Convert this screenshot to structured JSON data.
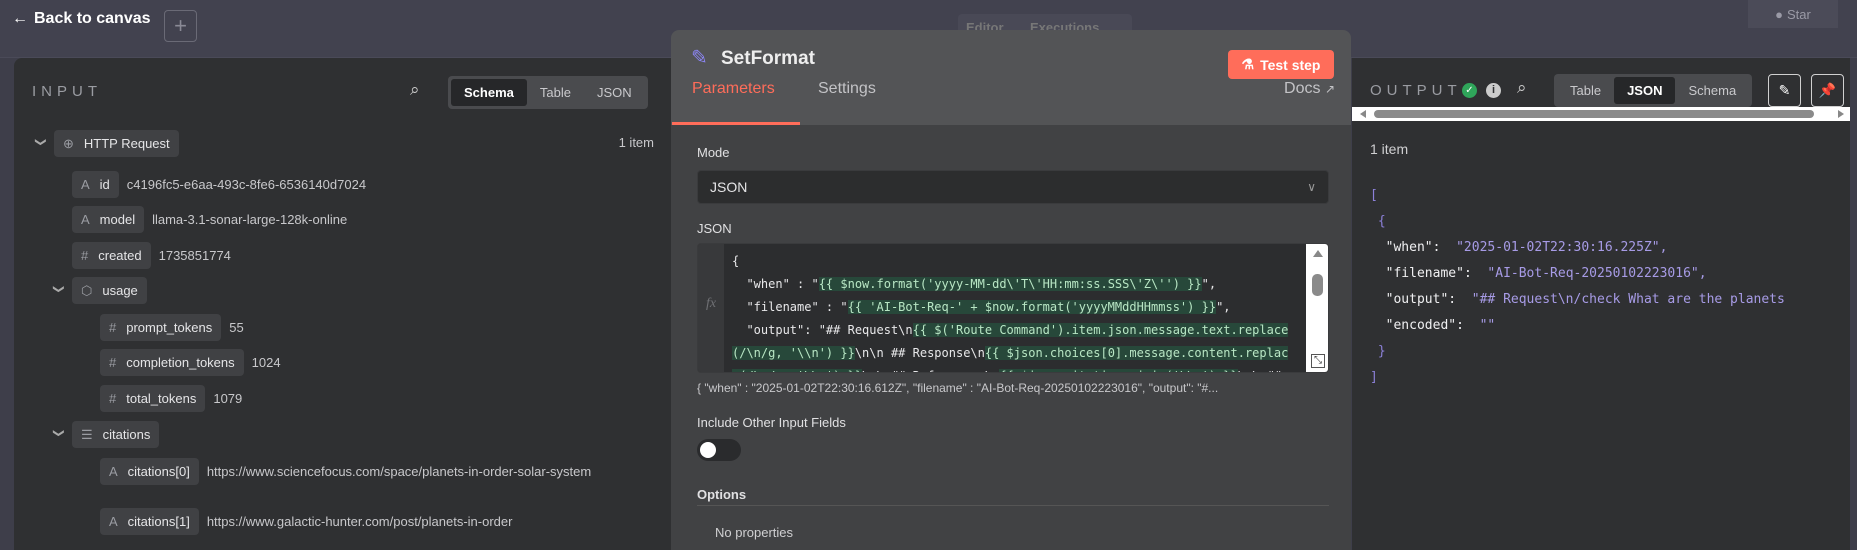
{
  "topbar": {
    "back_label": "Back to canvas",
    "editor_tab": "Editor",
    "executions_tab": "Executions",
    "star_label": "Star"
  },
  "input": {
    "title": "INPUT",
    "view_tabs": [
      "Schema",
      "Table",
      "JSON"
    ],
    "active_tab": "Schema",
    "tree": [
      {
        "level": 0,
        "expand": true,
        "icon": "globe-icon",
        "key": "HTTP Request",
        "value": "",
        "count": "1 item"
      },
      {
        "level": 1,
        "icon": "string-icon",
        "key": "id",
        "value": "c4196fc5-e6aa-493c-8fe6-6536140d7024"
      },
      {
        "level": 1,
        "icon": "string-icon",
        "key": "model",
        "value": "llama-3.1-sonar-large-128k-online"
      },
      {
        "level": 1,
        "icon": "number-icon",
        "key": "created",
        "value": "1735851774"
      },
      {
        "level": 1,
        "expand": true,
        "icon": "object-icon",
        "key": "usage",
        "value": ""
      },
      {
        "level": 2,
        "icon": "number-icon",
        "key": "prompt_tokens",
        "value": "55"
      },
      {
        "level": 2,
        "icon": "number-icon",
        "key": "completion_tokens",
        "value": "1024"
      },
      {
        "level": 2,
        "icon": "number-icon",
        "key": "total_tokens",
        "value": "1079"
      },
      {
        "level": 1,
        "expand": true,
        "icon": "list-icon",
        "key": "citations",
        "value": ""
      },
      {
        "level": 2,
        "icon": "string-icon",
        "key": "citations[0]",
        "value": "https://www.sciencefocus.com/space/planets-in-order-solar-system"
      },
      {
        "level": 2,
        "icon": "string-icon",
        "key": "citations[1]",
        "value": "https://www.galactic-hunter.com/post/planets-in-order"
      }
    ]
  },
  "node": {
    "title": "SetFormat",
    "test_label": "Test step",
    "tabs": [
      "Parameters",
      "Settings"
    ],
    "active_tab": "Parameters",
    "docs_label": "Docs",
    "mode_label": "Mode",
    "mode_value": "JSON",
    "json_label": "JSON",
    "code_lines": [
      [
        {
          "t": "{"
        }
      ],
      [
        {
          "t": "  \"when\" : \""
        },
        {
          "t": "{{ $now.format('yyyy-MM-dd\\'T\\'HH:mm:ss.SSS\\'Z\\'') }}",
          "ex": true
        },
        {
          "t": "\","
        }
      ],
      [
        {
          "t": "  \"filename\" : \""
        },
        {
          "t": "{{ 'AI-Bot-Req-' + $now.format('yyyyMMddHHmmss') }}",
          "ex": true
        },
        {
          "t": "\","
        }
      ],
      [
        {
          "t": "  \"output\": \"## Request\\n"
        },
        {
          "t": "{{ $('Route Command').item.json.message.text.replace",
          "ex": true
        }
      ],
      [
        {
          "t": "(/\\n/g, '\\\\n') }}",
          "ex": true
        },
        {
          "t": "\\n\\n ## Response\\n"
        },
        {
          "t": "{{ $json.choices[0].message.content.replac",
          "ex": true
        }
      ],
      [
        {
          "t": "e(/\\n/g, '\\\\n') }}",
          "ex": true
        },
        {
          "t": "\\n\\n## References\\n"
        },
        {
          "t": "{{ $json.citations.join('\\\\n') }}",
          "ex": true
        },
        {
          "t": "\\n\\n##"
        }
      ]
    ],
    "preview": "{   \"when\" : \"2025-01-02T22:30:16.612Z\",   \"filename\" : \"AI-Bot-Req-20250102223016\",   \"output\": \"#...",
    "include_label": "Include Other Input Fields",
    "include_on": false,
    "options_label": "Options",
    "no_properties": "No properties"
  },
  "output": {
    "title": "OUTPUT",
    "view_tabs": [
      "Table",
      "JSON",
      "Schema"
    ],
    "active_tab": "JSON",
    "count": "1 item",
    "fields": [
      {
        "key": "\"when\"",
        "value": "\"2025-01-02T22:30:16.225Z\","
      },
      {
        "key": "\"filename\"",
        "value": "\"AI-Bot-Req-20250102223016\","
      },
      {
        "key": "\"output\"",
        "value": "\"## Request\\n/check What are the planets"
      },
      {
        "key": "\"encoded\"",
        "value": "\"\""
      }
    ]
  },
  "colors": {
    "accent": "#ff6d5a",
    "success": "#2fa55a",
    "json_string": "#a79be6",
    "expression_bg": "#27483a"
  }
}
